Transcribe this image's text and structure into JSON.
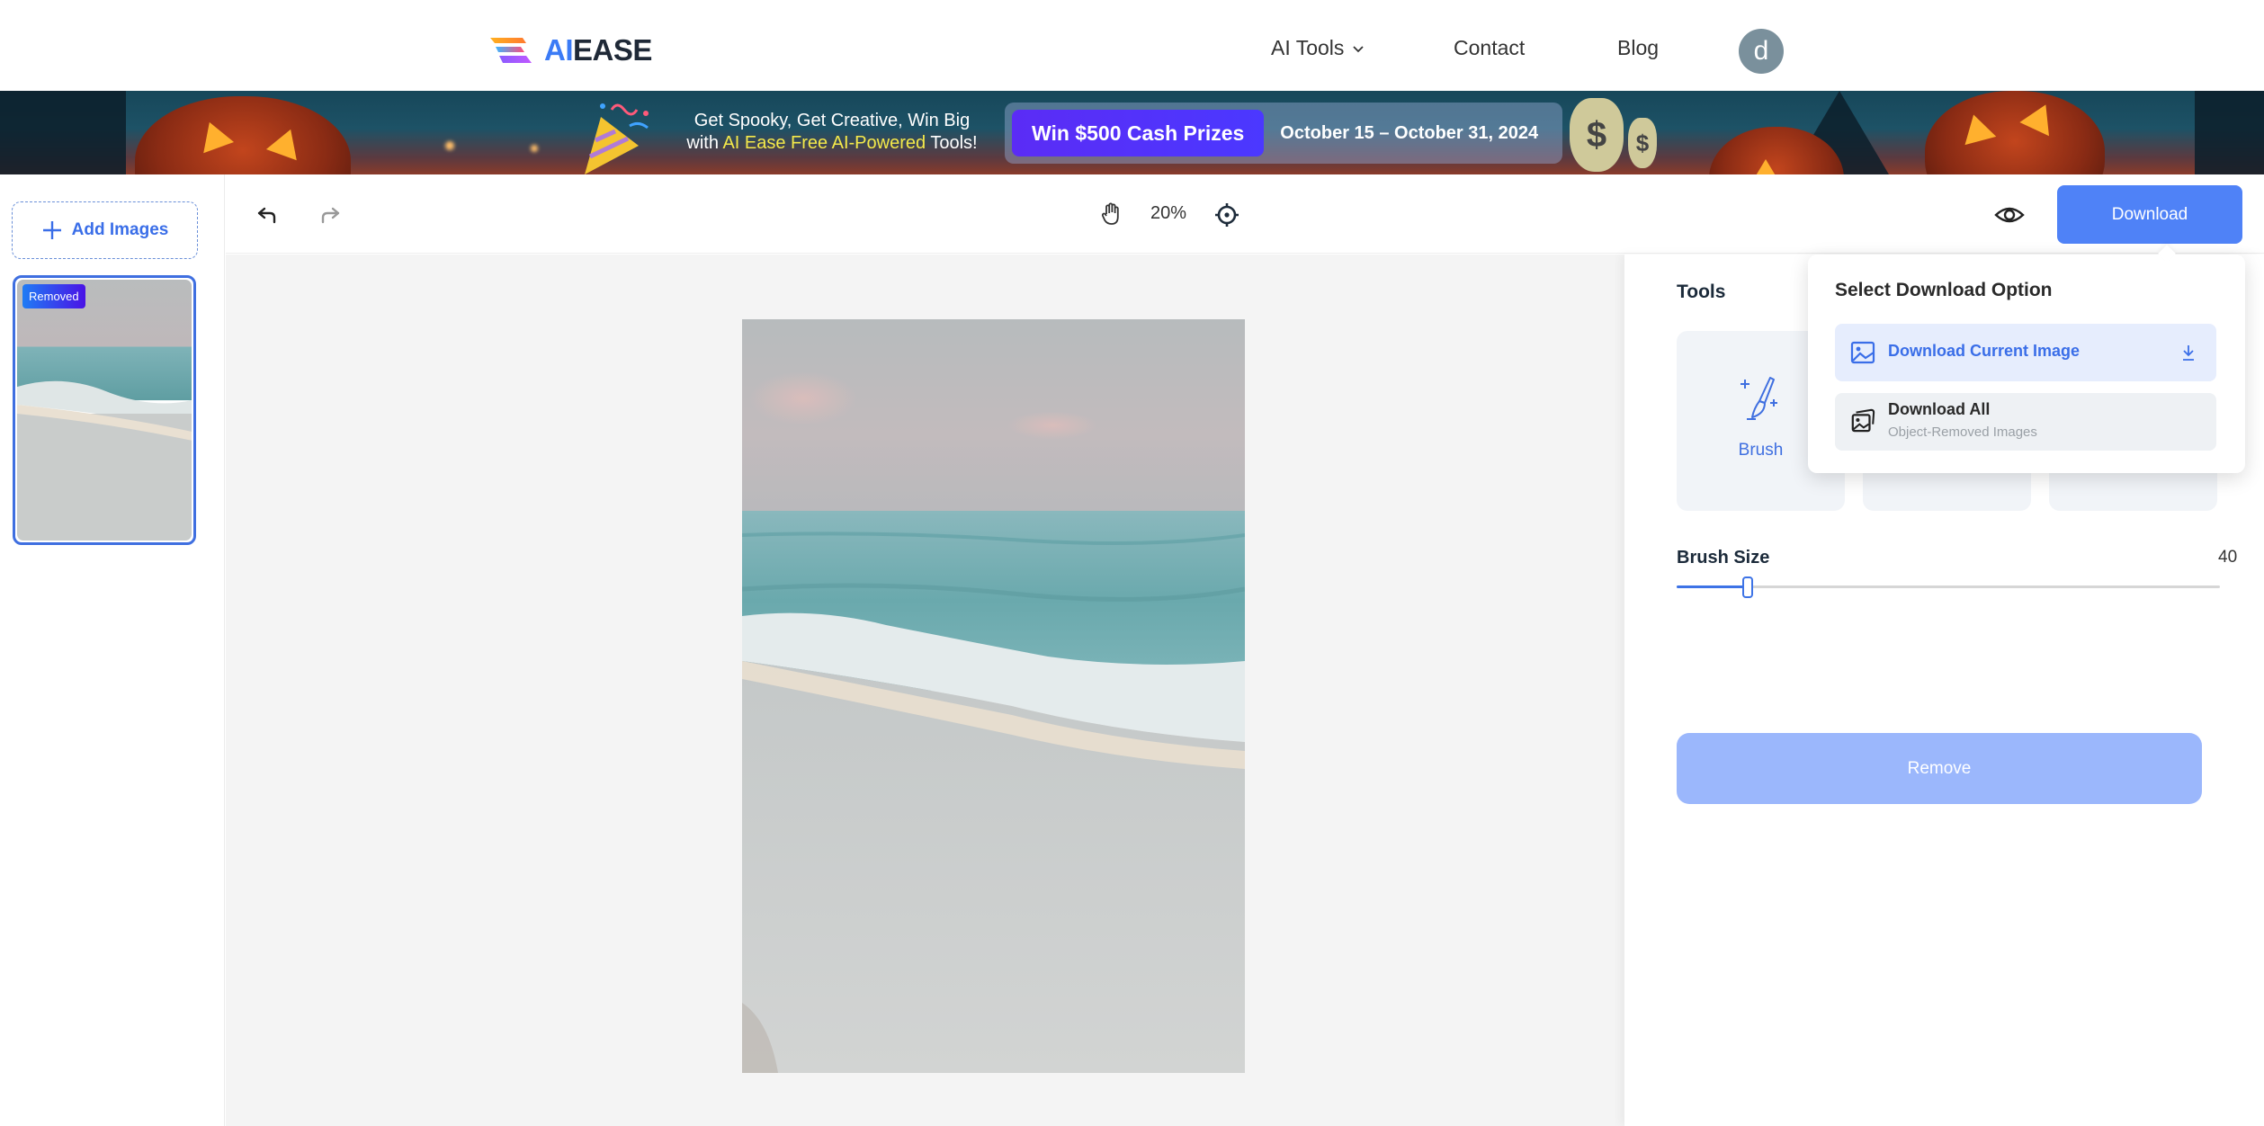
{
  "nav": {
    "logo": {
      "prefix": "AI",
      "suffix": "EASE"
    },
    "links": [
      {
        "label": "AI Tools",
        "has_dropdown": true
      },
      {
        "label": "Contact"
      },
      {
        "label": "Blog"
      }
    ],
    "avatar_initial": "d"
  },
  "banner": {
    "line1": "Get Spooky, Get Creative, Win Big",
    "line2_prefix": "with ",
    "line2_highlight": "AI Ease Free AI-Powered",
    "line2_suffix": " Tools!",
    "prize": "Win $500 Cash Prizes",
    "dates": "October 15 – October 31, 2024"
  },
  "sidebar": {
    "add_images_label": "Add Images",
    "thumbnails": [
      {
        "badge": "Removed",
        "selected": true
      }
    ]
  },
  "toolbar": {
    "undo_icon": "undo-icon",
    "redo_icon": "redo-icon",
    "pan_icon": "hand-icon",
    "zoom_level": "20%",
    "recenter_icon": "crosshair-icon",
    "preview_icon": "eye-icon",
    "download_label": "Download"
  },
  "panel": {
    "tools_title": "Tools",
    "tools": [
      {
        "label": "Brush",
        "icon": "brush-icon",
        "active": true
      },
      {
        "label": ""
      },
      {
        "label": ""
      }
    ],
    "brush_size": {
      "label": "Brush Size",
      "value": "40",
      "fraction": 0.13
    },
    "remove_label": "Remove"
  },
  "download_menu": {
    "title": "Select Download Option",
    "options": [
      {
        "label": "Download Current Image",
        "icon": "image-icon",
        "trailing_icon": "download-arrow-icon"
      },
      {
        "label": "Download All",
        "sublabel": "Object-Removed Images",
        "icon": "images-stack-icon"
      }
    ]
  },
  "colors": {
    "primary": "#4f82f7",
    "primary_text": "#3a6ee8",
    "remove_disabled": "#9bb7fc",
    "canvas_bg": "#f4f4f4",
    "avatar_bg": "#7a909c"
  }
}
